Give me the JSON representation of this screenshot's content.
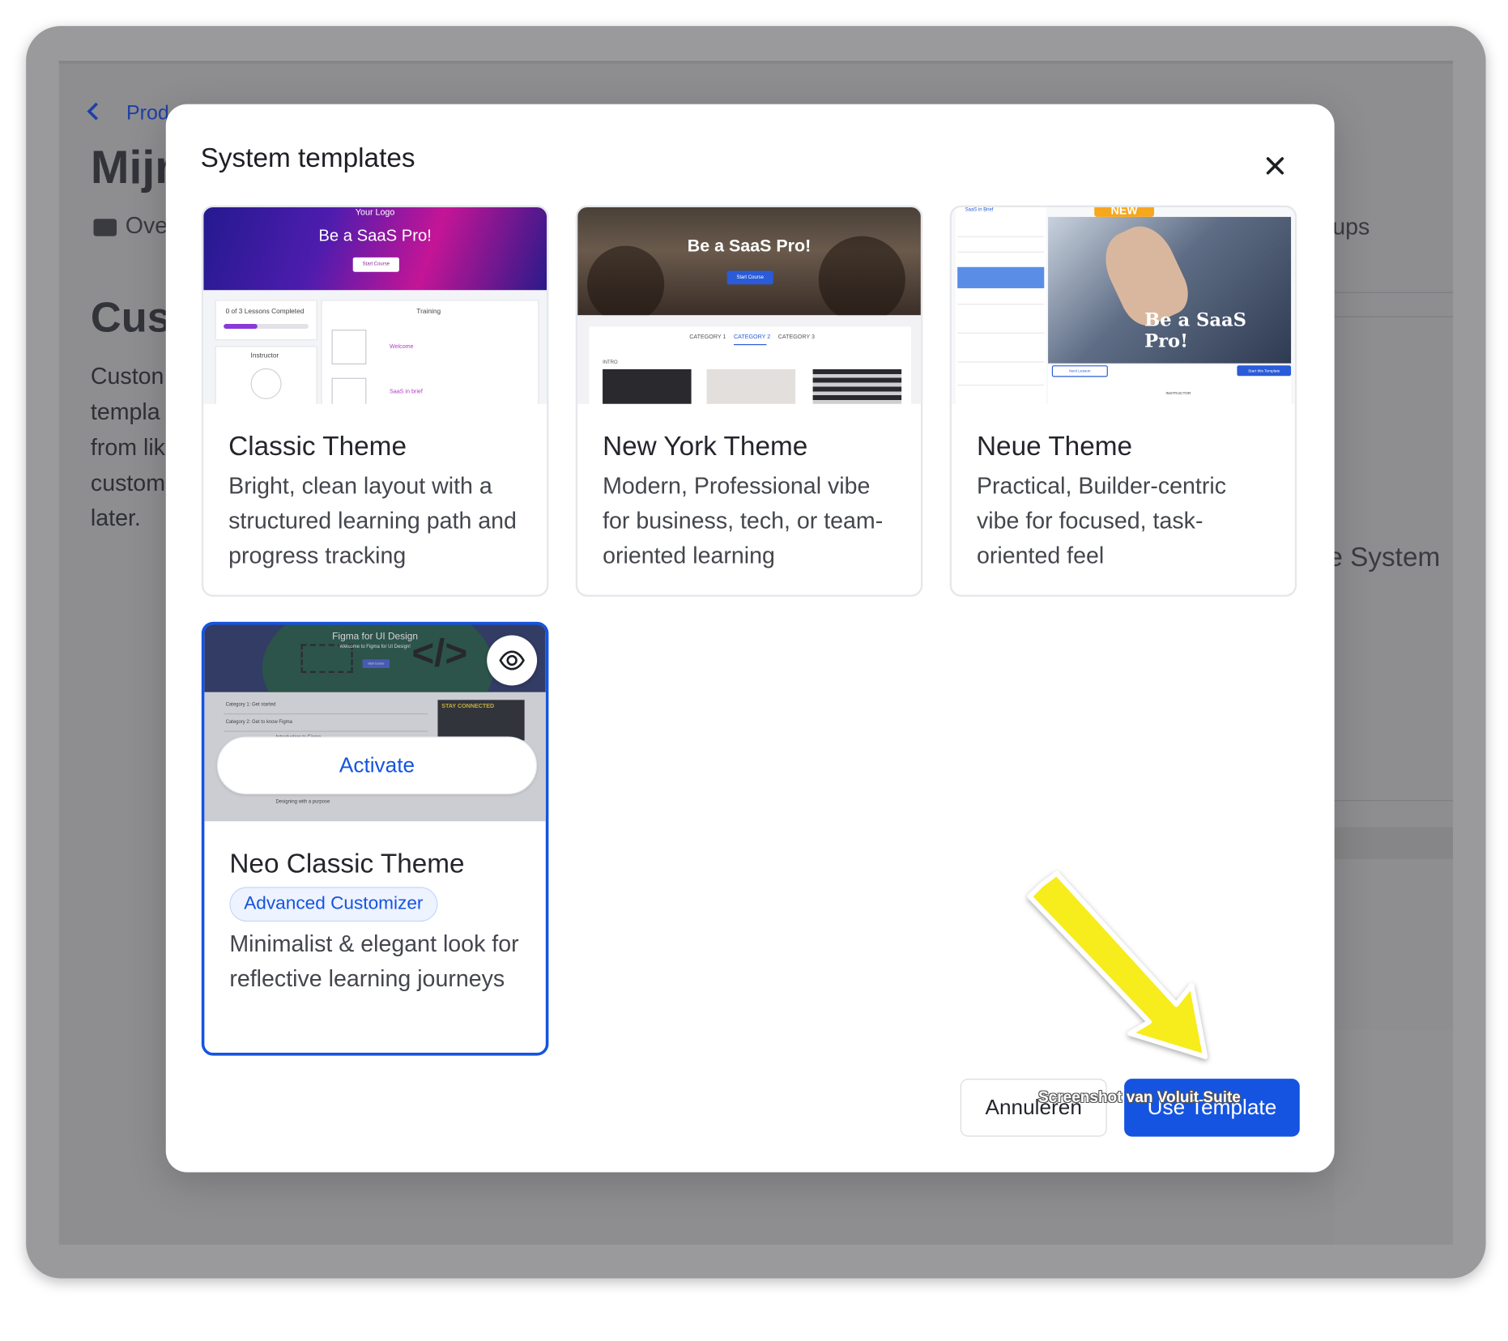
{
  "background": {
    "breadcrumb": "Prod",
    "page_title": "Mijr",
    "tab_overview": "Ove",
    "tab_groups": "ups",
    "section_heading": "Cus",
    "paragraph_lines": [
      "Custon",
      "templa",
      "from lik",
      "custom",
      "later."
    ],
    "right_label": "e System"
  },
  "modal": {
    "title": "System templates",
    "templates": [
      {
        "name": "Classic Theme",
        "description": "Bright, clean layout with a structured learning path and progress tracking",
        "preview": {
          "logo": "Your Logo",
          "hero_title": "Be a SaaS Pro!",
          "hero_button": "Start Course",
          "progress_label": "0 of 3 Lessons Completed",
          "progress_fraction": 0.4,
          "training_label": "Training",
          "instructor_label": "Instructor",
          "lesson_1": "Welcome",
          "lesson_2": "SaaS in brief"
        }
      },
      {
        "name": "New York Theme",
        "description": "Modern, Professional vibe for business, tech, or team-oriented learning",
        "preview": {
          "hero_title": "Be a SaaS Pro!",
          "hero_button": "Start Course",
          "categories": [
            "CATEGORY 1",
            "CATEGORY 2",
            "CATEGORY 3"
          ],
          "intro_label": "INTRO"
        }
      },
      {
        "name": "Neue Theme",
        "description": "Practical, Builder-centric vibe for focused, task-oriented feel",
        "preview": {
          "badge": "NEW",
          "hero_title": "Be a SaaS Pro!",
          "link": "SaaS in Brief",
          "button_left": "Next Lesson",
          "button_right": "Start this Template",
          "instructor_label": "INSTRUCTOR"
        }
      },
      {
        "name": "Neo Classic Theme",
        "badge": "Advanced Customizer",
        "description": "Minimalist & elegant look for reflective learning journeys",
        "selected": true,
        "preview": {
          "hero_title": "Figma for UI Design",
          "hero_subtitle": "Welcome to Figma for UI Design!",
          "hero_button": "Start Course",
          "category_1": "Category 1: Get started",
          "category_2": "Category 2: Get to know Figma",
          "lesson": "Introduction to Figma",
          "lesson_2": "Designing with a purpose",
          "stay_connected": "STAY CONNECTED"
        },
        "activate_label": "Activate"
      }
    ],
    "cancel_label": "Annuleren",
    "use_label": "Use Template"
  },
  "credit": "Screenshot van Voluit Suite",
  "colors": {
    "accent": "#1554e0",
    "arrow": "#f7ec1a"
  },
  "icons": [
    "chevron-left-icon",
    "overview-icon",
    "close-icon",
    "eye-icon",
    "arrow-annotation-icon"
  ]
}
